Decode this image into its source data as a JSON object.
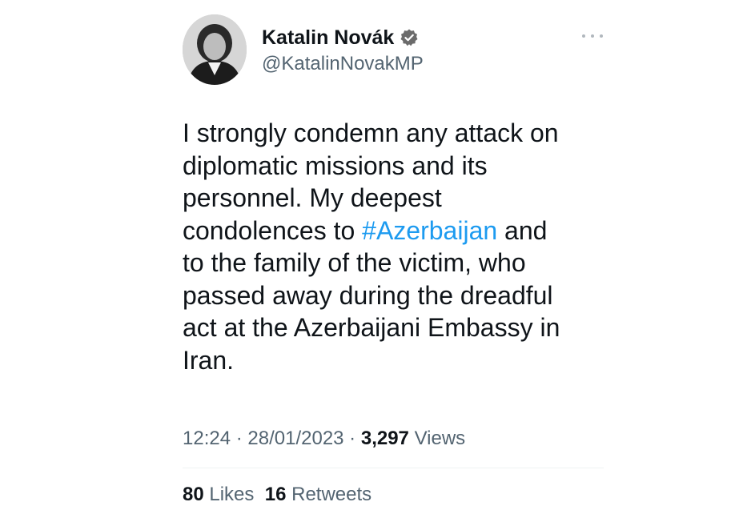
{
  "author": {
    "name": "Katalin Novák",
    "handle": "@KatalinNovakMP",
    "verified": true,
    "verified_color": "#1d9bf0"
  },
  "icons": {
    "avatar": "profile-photo",
    "verified": "verified-badge-icon",
    "more": "more-options-icon"
  },
  "tweet": {
    "lines": [
      "I strongly condemn any attack on",
      "diplomatic missions and its",
      "personnel. My deepest",
      "condolences to ",
      "to the family of the victim, who",
      "passed away during the dreadful",
      "act at the Azerbaijani Embassy in",
      "Iran."
    ],
    "hashtag": "#Azerbaijan",
    "after_hashtag": " and",
    "hashtag_color": "#1d9bf0"
  },
  "meta": {
    "time": "12:24",
    "sep1": " · ",
    "date": "28/01/2023",
    "sep2": " · ",
    "views_count": "3,297",
    "views_label": " Views"
  },
  "stats": {
    "likes_count": "80",
    "likes_label": " Likes",
    "retweets_count": "16",
    "retweets_label": " Retweets"
  }
}
